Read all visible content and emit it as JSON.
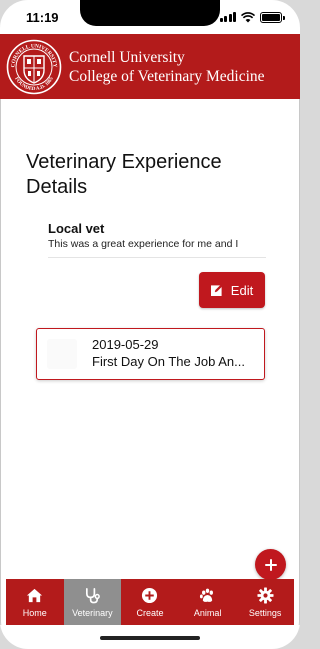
{
  "status_bar": {
    "time": "11:19",
    "icons": [
      "signal-icon",
      "wifi-icon",
      "battery-icon"
    ]
  },
  "header": {
    "line1": "Cornell University",
    "line2": "College of Veterinary Medicine",
    "seal_text_top": "CORNELL UNIVERSITY",
    "seal_text_bottom": "FOUNDED A.D. 1865",
    "brand_color": "#b31b1b"
  },
  "page": {
    "title": "Veterinary Experience Details"
  },
  "experience": {
    "title": "Local vet",
    "description": "This was a great experience for me and I",
    "edit_label": "Edit"
  },
  "journal": {
    "date": "2019-05-29",
    "title": "First Day On The Job An..."
  },
  "fab": {
    "icon": "plus-icon"
  },
  "tabs": [
    {
      "label": "Home",
      "icon": "home-icon",
      "active": false
    },
    {
      "label": "Veterinary",
      "icon": "stethoscope-icon",
      "active": true
    },
    {
      "label": "Create",
      "icon": "plus-circle-icon",
      "active": false
    },
    {
      "label": "Animal",
      "icon": "paw-icon",
      "active": false
    },
    {
      "label": "Settings",
      "icon": "gear-icon",
      "active": false
    }
  ],
  "colors": {
    "accent": "#c0181e",
    "active_tab": "#8f8f8f"
  }
}
